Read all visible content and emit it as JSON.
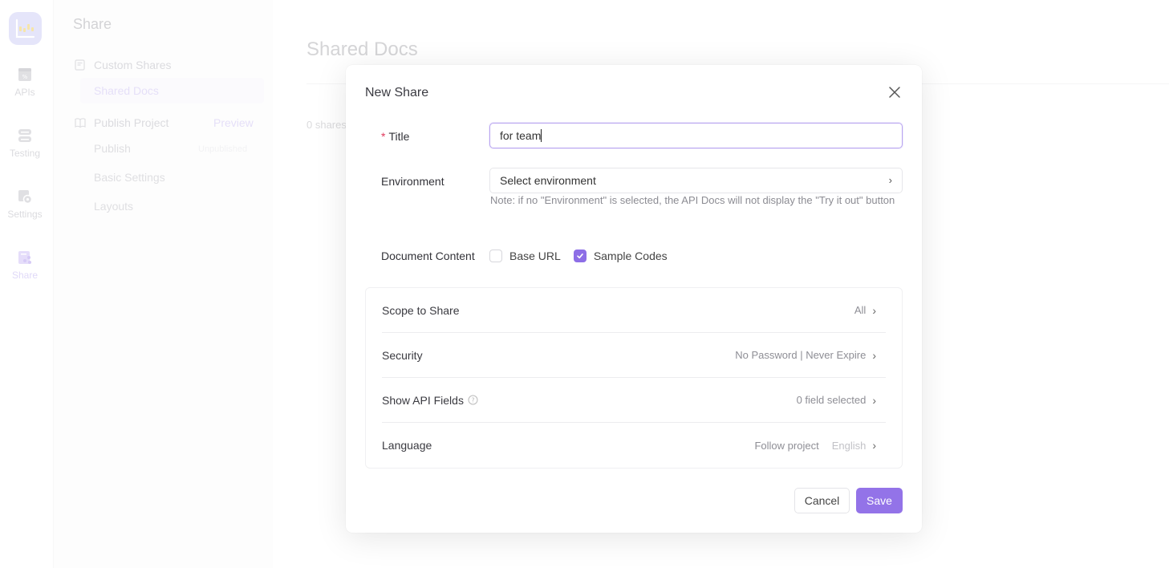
{
  "rail": {
    "items": [
      {
        "label": "APIs",
        "icon": "api-icon"
      },
      {
        "label": "Testing",
        "icon": "testing-icon"
      },
      {
        "label": "Settings",
        "icon": "settings-icon"
      },
      {
        "label": "Share",
        "icon": "share-icon",
        "active": true
      }
    ]
  },
  "sidebar": {
    "title": "Share",
    "custom_shares": "Custom Shares",
    "shared_docs": "Shared Docs",
    "publish_project": "Publish Project",
    "preview": "Preview",
    "publish": "Publish",
    "unpublished": "Unpublished",
    "basic_settings": "Basic Settings",
    "layouts": "Layouts"
  },
  "main": {
    "title": "Shared Docs",
    "count": "0 shares"
  },
  "modal": {
    "title": "New Share",
    "title_label": "Title",
    "required_mark": "*",
    "title_value": "for team",
    "environment_label": "Environment",
    "environment_placeholder": "Select environment",
    "environment_note": "Note: if no \"Environment\" is selected, the API Docs will not display the \"Try it out\" button",
    "content_label": "Document Content",
    "options": [
      {
        "label": "Base URL",
        "checked": false
      },
      {
        "label": "Sample Codes",
        "checked": true
      }
    ],
    "settings": [
      {
        "label": "Scope to Share",
        "value": "All"
      },
      {
        "label": "Security",
        "value": "No Password | Never Expire"
      },
      {
        "label": "Show API Fields",
        "value": "0 field selected",
        "help": true
      },
      {
        "label": "Language",
        "value": "Follow project",
        "secondary": "English"
      }
    ],
    "cancel_label": "Cancel",
    "save_label": "Save"
  },
  "colors": {
    "accent": "#9373e8",
    "required": "#e0385c"
  }
}
